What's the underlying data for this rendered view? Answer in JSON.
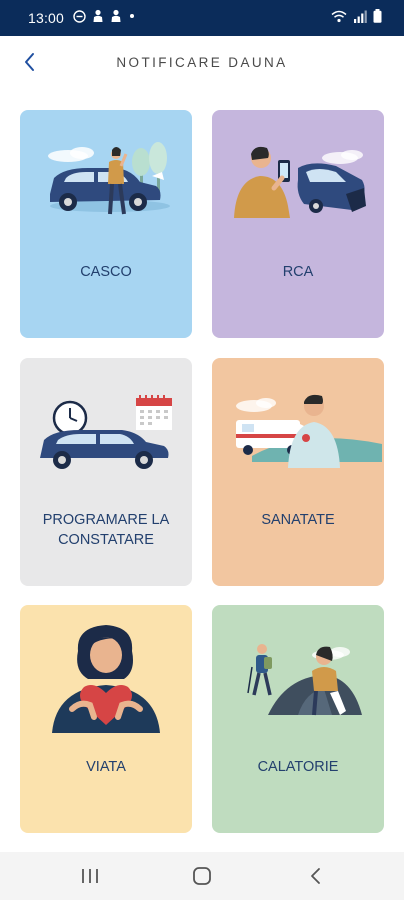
{
  "status_bar": {
    "time": "13:00",
    "left_icons": [
      "minus-circle-icon",
      "person-icon",
      "person-icon",
      "dot-icon"
    ],
    "right_icons": [
      "wifi-icon",
      "signal-icon",
      "battery-icon"
    ]
  },
  "header": {
    "title": "NOTIFICARE DAUNA",
    "back_icon": "chevron-left-icon"
  },
  "cards": [
    {
      "label": "CASCO",
      "color": "#a7d5f2",
      "illustration": "car-accident-illustration"
    },
    {
      "label": "RCA",
      "color": "#c5b6dd",
      "illustration": "phone-car-crash-illustration"
    },
    {
      "label_line1": "PROGRAMARE LA",
      "label_line2": "CONSTATARE",
      "color": "#e8e8e9",
      "illustration": "car-clock-calendar-illustration"
    },
    {
      "label": "SANATATE",
      "color": "#f2c6a0",
      "illustration": "ambulance-doctor-illustration"
    },
    {
      "label": "VIATA",
      "color": "#fbe2ad",
      "illustration": "woman-heart-illustration"
    },
    {
      "label": "CALATORIE",
      "color": "#bfdcbf",
      "illustration": "hiker-rock-illustration"
    }
  ],
  "navbar": {
    "buttons": [
      "recent-apps-icon",
      "home-icon",
      "back-icon"
    ]
  },
  "colors": {
    "status_bar": "#0b2c5a",
    "label_text": "#23406e",
    "accent_blue": "#1f4fa0"
  }
}
